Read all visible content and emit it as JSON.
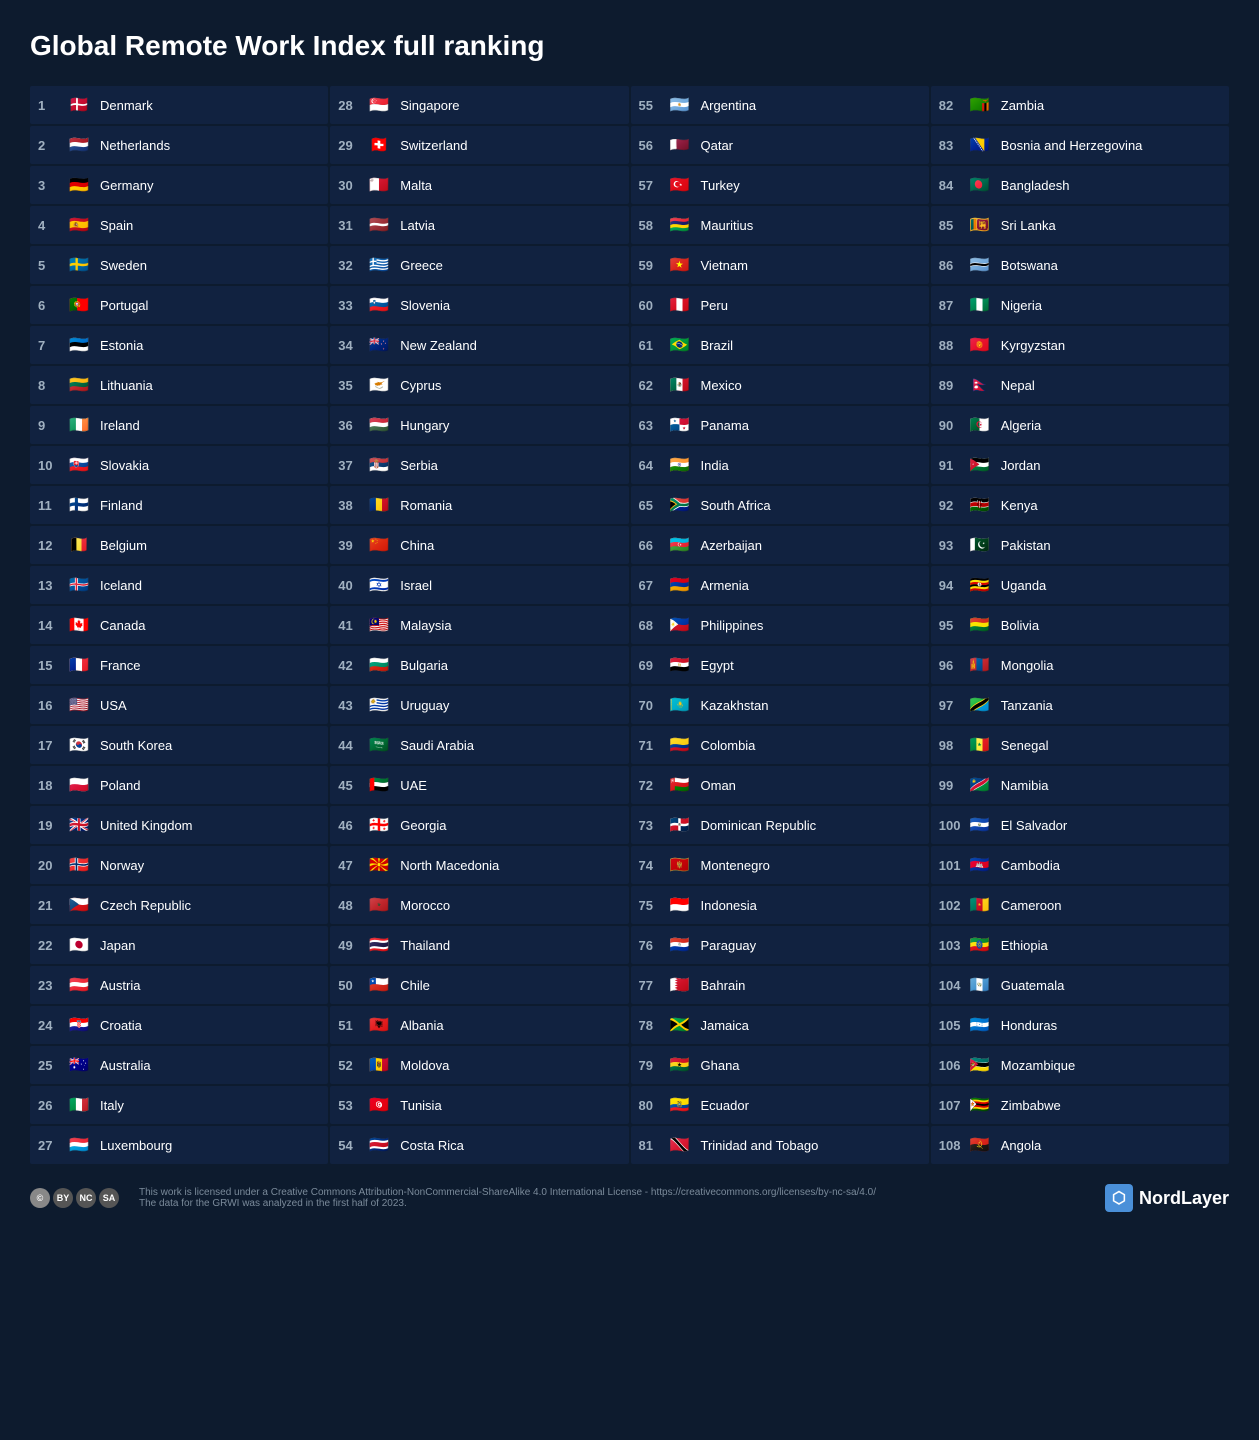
{
  "title": "Global Remote Work Index full ranking",
  "countries": [
    {
      "rank": 1,
      "name": "Denmark",
      "flag": "🇩🇰"
    },
    {
      "rank": 2,
      "name": "Netherlands",
      "flag": "🇳🇱"
    },
    {
      "rank": 3,
      "name": "Germany",
      "flag": "🇩🇪"
    },
    {
      "rank": 4,
      "name": "Spain",
      "flag": "🇪🇸"
    },
    {
      "rank": 5,
      "name": "Sweden",
      "flag": "🇸🇪"
    },
    {
      "rank": 6,
      "name": "Portugal",
      "flag": "🇵🇹"
    },
    {
      "rank": 7,
      "name": "Estonia",
      "flag": "🇪🇪"
    },
    {
      "rank": 8,
      "name": "Lithuania",
      "flag": "🇱🇹"
    },
    {
      "rank": 9,
      "name": "Ireland",
      "flag": "🇮🇪"
    },
    {
      "rank": 10,
      "name": "Slovakia",
      "flag": "🇸🇰"
    },
    {
      "rank": 11,
      "name": "Finland",
      "flag": "🇫🇮"
    },
    {
      "rank": 12,
      "name": "Belgium",
      "flag": "🇧🇪"
    },
    {
      "rank": 13,
      "name": "Iceland",
      "flag": "🇮🇸"
    },
    {
      "rank": 14,
      "name": "Canada",
      "flag": "🇨🇦"
    },
    {
      "rank": 15,
      "name": "France",
      "flag": "🇫🇷"
    },
    {
      "rank": 16,
      "name": "USA",
      "flag": "🇺🇸"
    },
    {
      "rank": 17,
      "name": "South Korea",
      "flag": "🇰🇷"
    },
    {
      "rank": 18,
      "name": "Poland",
      "flag": "🇵🇱"
    },
    {
      "rank": 19,
      "name": "United Kingdom",
      "flag": "🇬🇧"
    },
    {
      "rank": 20,
      "name": "Norway",
      "flag": "🇳🇴"
    },
    {
      "rank": 21,
      "name": "Czech Republic",
      "flag": "🇨🇿"
    },
    {
      "rank": 22,
      "name": "Japan",
      "flag": "🇯🇵"
    },
    {
      "rank": 23,
      "name": "Austria",
      "flag": "🇦🇹"
    },
    {
      "rank": 24,
      "name": "Croatia",
      "flag": "🇭🇷"
    },
    {
      "rank": 25,
      "name": "Australia",
      "flag": "🇦🇺"
    },
    {
      "rank": 26,
      "name": "Italy",
      "flag": "🇮🇹"
    },
    {
      "rank": 27,
      "name": "Luxembourg",
      "flag": "🇱🇺"
    },
    {
      "rank": 28,
      "name": "Singapore",
      "flag": "🇸🇬"
    },
    {
      "rank": 29,
      "name": "Switzerland",
      "flag": "🇨🇭"
    },
    {
      "rank": 30,
      "name": "Malta",
      "flag": "🇲🇹"
    },
    {
      "rank": 31,
      "name": "Latvia",
      "flag": "🇱🇻"
    },
    {
      "rank": 32,
      "name": "Greece",
      "flag": "🇬🇷"
    },
    {
      "rank": 33,
      "name": "Slovenia",
      "flag": "🇸🇮"
    },
    {
      "rank": 34,
      "name": "New Zealand",
      "flag": "🇳🇿"
    },
    {
      "rank": 35,
      "name": "Cyprus",
      "flag": "🇨🇾"
    },
    {
      "rank": 36,
      "name": "Hungary",
      "flag": "🇭🇺"
    },
    {
      "rank": 37,
      "name": "Serbia",
      "flag": "🇷🇸"
    },
    {
      "rank": 38,
      "name": "Romania",
      "flag": "🇷🇴"
    },
    {
      "rank": 39,
      "name": "China",
      "flag": "🇨🇳"
    },
    {
      "rank": 40,
      "name": "Israel",
      "flag": "🇮🇱"
    },
    {
      "rank": 41,
      "name": "Malaysia",
      "flag": "🇲🇾"
    },
    {
      "rank": 42,
      "name": "Bulgaria",
      "flag": "🇧🇬"
    },
    {
      "rank": 43,
      "name": "Uruguay",
      "flag": "🇺🇾"
    },
    {
      "rank": 44,
      "name": "Saudi Arabia",
      "flag": "🇸🇦"
    },
    {
      "rank": 45,
      "name": "UAE",
      "flag": "🇦🇪"
    },
    {
      "rank": 46,
      "name": "Georgia",
      "flag": "🇬🇪"
    },
    {
      "rank": 47,
      "name": "North Macedonia",
      "flag": "🇲🇰"
    },
    {
      "rank": 48,
      "name": "Morocco",
      "flag": "🇲🇦"
    },
    {
      "rank": 49,
      "name": "Thailand",
      "flag": "🇹🇭"
    },
    {
      "rank": 50,
      "name": "Chile",
      "flag": "🇨🇱"
    },
    {
      "rank": 51,
      "name": "Albania",
      "flag": "🇦🇱"
    },
    {
      "rank": 52,
      "name": "Moldova",
      "flag": "🇲🇩"
    },
    {
      "rank": 53,
      "name": "Tunisia",
      "flag": "🇹🇳"
    },
    {
      "rank": 54,
      "name": "Costa Rica",
      "flag": "🇨🇷"
    },
    {
      "rank": 55,
      "name": "Argentina",
      "flag": "🇦🇷"
    },
    {
      "rank": 56,
      "name": "Qatar",
      "flag": "🇶🇦"
    },
    {
      "rank": 57,
      "name": "Turkey",
      "flag": "🇹🇷"
    },
    {
      "rank": 58,
      "name": "Mauritius",
      "flag": "🇲🇺"
    },
    {
      "rank": 59,
      "name": "Vietnam",
      "flag": "🇻🇳"
    },
    {
      "rank": 60,
      "name": "Peru",
      "flag": "🇵🇪"
    },
    {
      "rank": 61,
      "name": "Brazil",
      "flag": "🇧🇷"
    },
    {
      "rank": 62,
      "name": "Mexico",
      "flag": "🇲🇽"
    },
    {
      "rank": 63,
      "name": "Panama",
      "flag": "🇵🇦"
    },
    {
      "rank": 64,
      "name": "India",
      "flag": "🇮🇳"
    },
    {
      "rank": 65,
      "name": "South Africa",
      "flag": "🇿🇦"
    },
    {
      "rank": 66,
      "name": "Azerbaijan",
      "flag": "🇦🇿"
    },
    {
      "rank": 67,
      "name": "Armenia",
      "flag": "🇦🇲"
    },
    {
      "rank": 68,
      "name": "Philippines",
      "flag": "🇵🇭"
    },
    {
      "rank": 69,
      "name": "Egypt",
      "flag": "🇪🇬"
    },
    {
      "rank": 70,
      "name": "Kazakhstan",
      "flag": "🇰🇿"
    },
    {
      "rank": 71,
      "name": "Colombia",
      "flag": "🇨🇴"
    },
    {
      "rank": 72,
      "name": "Oman",
      "flag": "🇴🇲"
    },
    {
      "rank": 73,
      "name": "Dominican Republic",
      "flag": "🇩🇴"
    },
    {
      "rank": 74,
      "name": "Montenegro",
      "flag": "🇲🇪"
    },
    {
      "rank": 75,
      "name": "Indonesia",
      "flag": "🇮🇩"
    },
    {
      "rank": 76,
      "name": "Paraguay",
      "flag": "🇵🇾"
    },
    {
      "rank": 77,
      "name": "Bahrain",
      "flag": "🇧🇭"
    },
    {
      "rank": 78,
      "name": "Jamaica",
      "flag": "🇯🇲"
    },
    {
      "rank": 79,
      "name": "Ghana",
      "flag": "🇬🇭"
    },
    {
      "rank": 80,
      "name": "Ecuador",
      "flag": "🇪🇨"
    },
    {
      "rank": 81,
      "name": "Trinidad and Tobago",
      "flag": "🇹🇹"
    },
    {
      "rank": 82,
      "name": "Zambia",
      "flag": "🇿🇲"
    },
    {
      "rank": 83,
      "name": "Bosnia and Herzegovina",
      "flag": "🇧🇦"
    },
    {
      "rank": 84,
      "name": "Bangladesh",
      "flag": "🇧🇩"
    },
    {
      "rank": 85,
      "name": "Sri Lanka",
      "flag": "🇱🇰"
    },
    {
      "rank": 86,
      "name": "Botswana",
      "flag": "🇧🇼"
    },
    {
      "rank": 87,
      "name": "Nigeria",
      "flag": "🇳🇬"
    },
    {
      "rank": 88,
      "name": "Kyrgyzstan",
      "flag": "🇰🇬"
    },
    {
      "rank": 89,
      "name": "Nepal",
      "flag": "🇳🇵"
    },
    {
      "rank": 90,
      "name": "Algeria",
      "flag": "🇩🇿"
    },
    {
      "rank": 91,
      "name": "Jordan",
      "flag": "🇯🇴"
    },
    {
      "rank": 92,
      "name": "Kenya",
      "flag": "🇰🇪"
    },
    {
      "rank": 93,
      "name": "Pakistan",
      "flag": "🇵🇰"
    },
    {
      "rank": 94,
      "name": "Uganda",
      "flag": "🇺🇬"
    },
    {
      "rank": 95,
      "name": "Bolivia",
      "flag": "🇧🇴"
    },
    {
      "rank": 96,
      "name": "Mongolia",
      "flag": "🇲🇳"
    },
    {
      "rank": 97,
      "name": "Tanzania",
      "flag": "🇹🇿"
    },
    {
      "rank": 98,
      "name": "Senegal",
      "flag": "🇸🇳"
    },
    {
      "rank": 99,
      "name": "Namibia",
      "flag": "🇳🇦"
    },
    {
      "rank": 100,
      "name": "El Salvador",
      "flag": "🇸🇻"
    },
    {
      "rank": 101,
      "name": "Cambodia",
      "flag": "🇰🇭"
    },
    {
      "rank": 102,
      "name": "Cameroon",
      "flag": "🇨🇲"
    },
    {
      "rank": 103,
      "name": "Ethiopia",
      "flag": "🇪🇹"
    },
    {
      "rank": 104,
      "name": "Guatemala",
      "flag": "🇬🇹"
    },
    {
      "rank": 105,
      "name": "Honduras",
      "flag": "🇭🇳"
    },
    {
      "rank": 106,
      "name": "Mozambique",
      "flag": "🇲🇿"
    },
    {
      "rank": 107,
      "name": "Zimbabwe",
      "flag": "🇿🇼"
    },
    {
      "rank": 108,
      "name": "Angola",
      "flag": "🇦🇴"
    }
  ],
  "footer": {
    "license_text": "This work is licensed under a Creative Commons Attribution-NonCommercial-ShareAlike 4.0 International License - https://creativecommons.org/licenses/by-nc-sa/4.0/",
    "data_note": "The data for the GRWI was analyzed in the first half of 2023.",
    "brand": "NordLayer"
  }
}
